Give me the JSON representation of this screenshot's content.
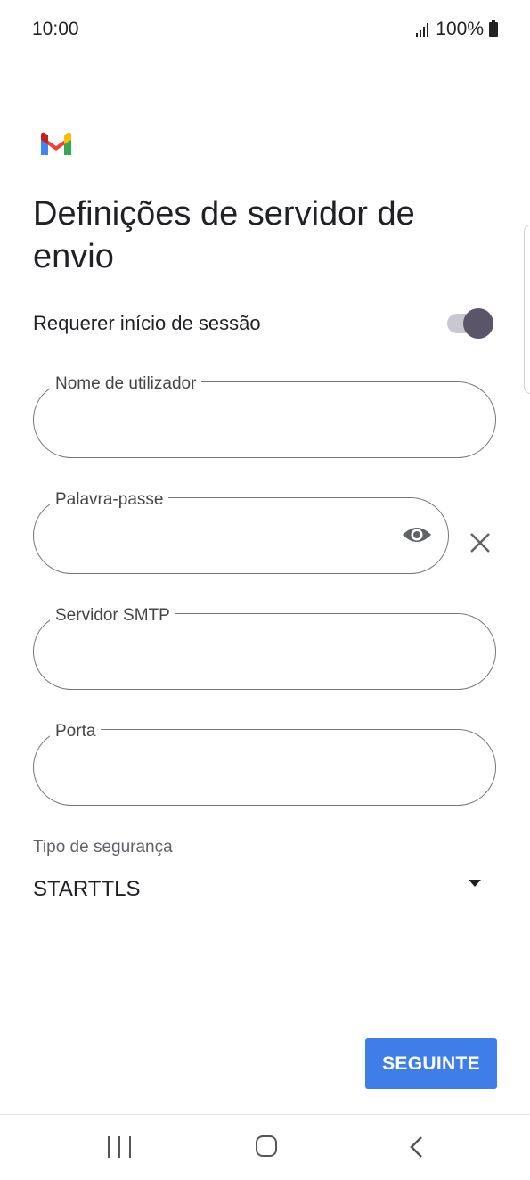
{
  "status_bar": {
    "time": "10:00",
    "battery": "100%"
  },
  "screen": {
    "title": "Definições de servidor de envio"
  },
  "login_toggle": {
    "label": "Requerer início de sessão",
    "checked": true
  },
  "fields": {
    "username": {
      "label": "Nome de utilizador",
      "value": ""
    },
    "password": {
      "label": "Palavra-passe",
      "value": ""
    },
    "smtp_server": {
      "label": "Servidor SMTP",
      "value": ""
    },
    "port": {
      "label": "Porta",
      "value": ""
    }
  },
  "security_type": {
    "label": "Tipo de segurança",
    "value": "STARTTLS"
  },
  "next_button": {
    "label": "SEGUINTE"
  },
  "icons": [
    "gmail-logo",
    "visibility-icon",
    "close-icon",
    "recent-apps-icon",
    "home-icon",
    "back-icon",
    "signal-icon",
    "battery-icon"
  ],
  "colors": {
    "accent": "#3f7ee8",
    "toggle_knob": "#5b5569",
    "toggle_track": "#c9c7cf"
  }
}
